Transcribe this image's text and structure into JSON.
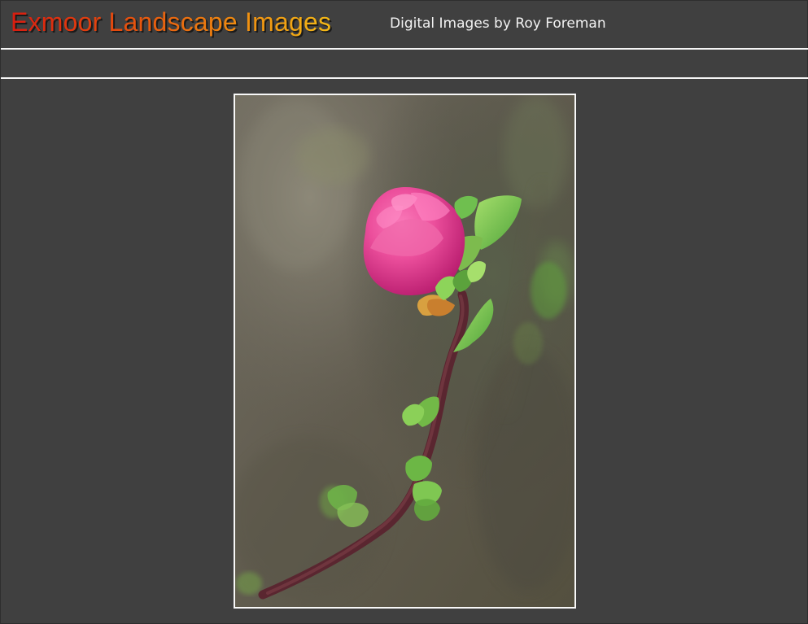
{
  "header": {
    "title": "Exmoor Landscape Images",
    "subtitle": "Digital Images by Roy Foreman"
  },
  "photo": {
    "subject": "pink-flower-bud-icon"
  },
  "colors": {
    "background": "#404040",
    "rule": "#f5f5f5",
    "title_gradient_start": "#d81d10",
    "title_gradient_end": "#f4b917",
    "subtitle": "#f2f2f2"
  }
}
